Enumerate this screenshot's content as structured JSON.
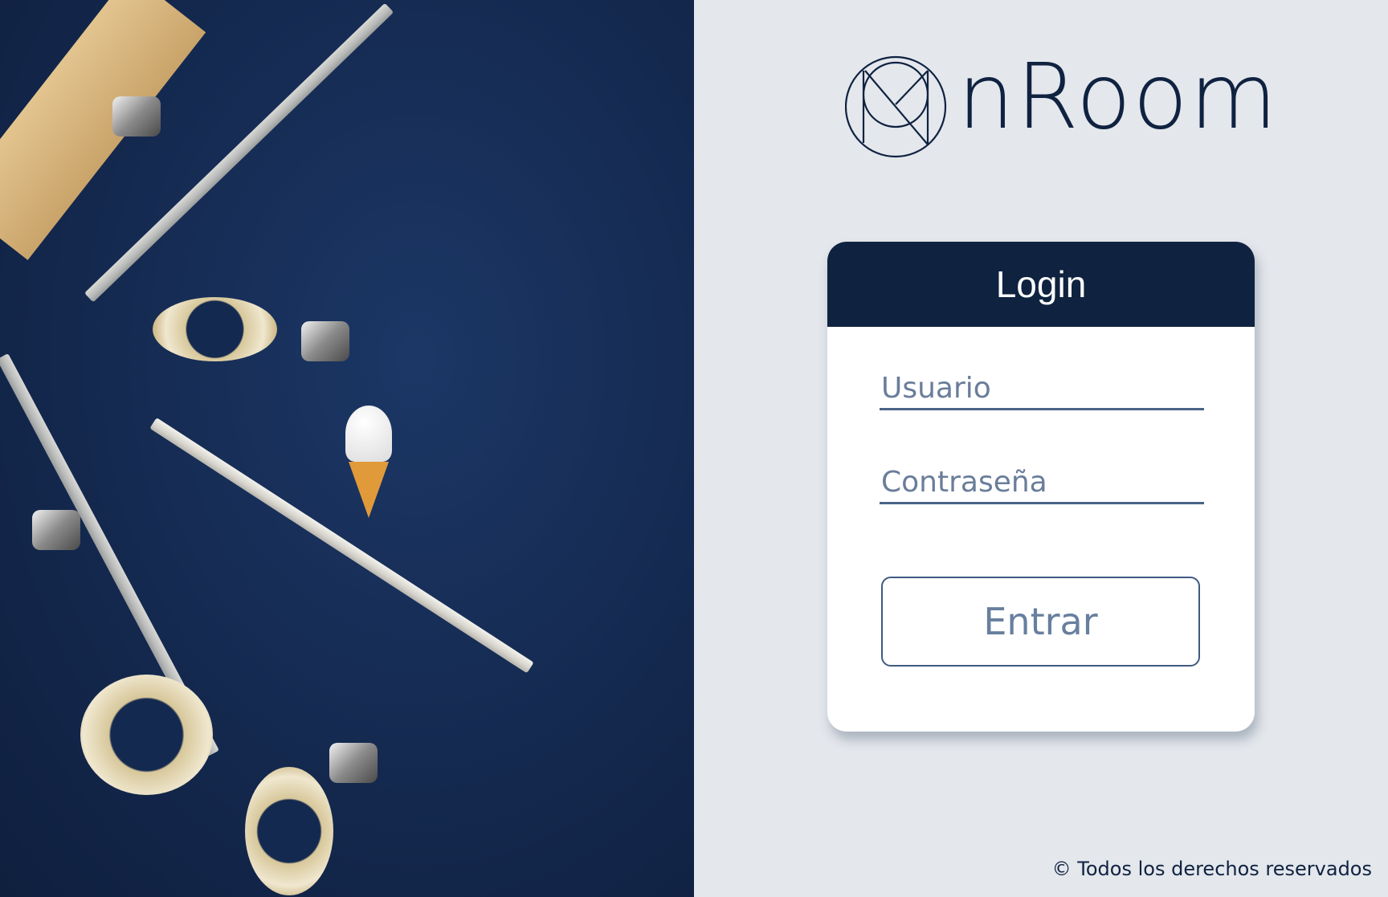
{
  "brand": {
    "name": "nRoom",
    "logo_mark": "M",
    "color": "#0f2240"
  },
  "login": {
    "title": "Login",
    "username_placeholder": "Usuario",
    "password_placeholder": "Contraseña",
    "submit_label": "Entrar"
  },
  "footer": {
    "copyright": "© Todos los derechos reservados"
  },
  "colors": {
    "background": "#e4e7ec",
    "header": "#0f2240",
    "accent": "#4a6388"
  }
}
